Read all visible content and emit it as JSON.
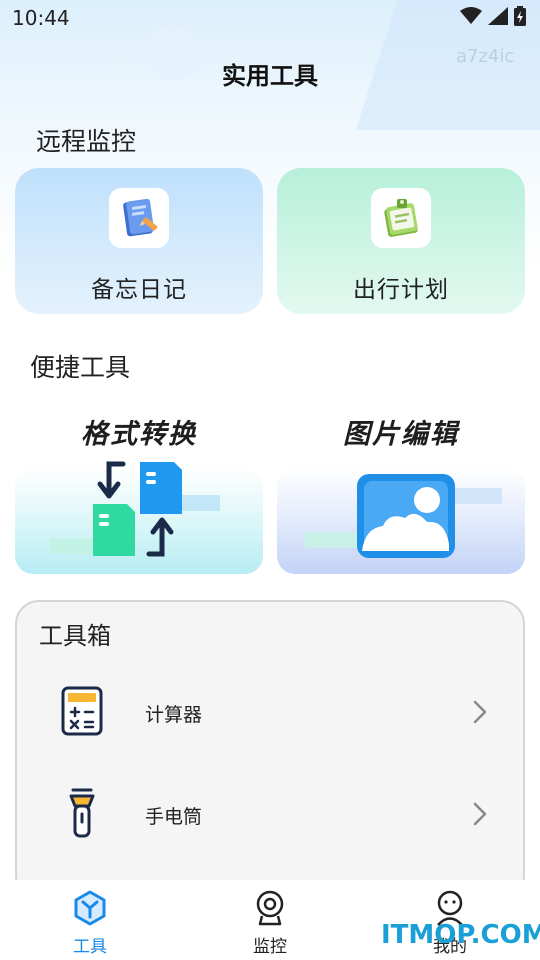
{
  "status": {
    "time": "10:44",
    "icons": [
      "wifi-icon",
      "signal-icon",
      "battery-icon"
    ]
  },
  "watermark_top": "a7z4ic",
  "header": {
    "title": "实用工具"
  },
  "remote": {
    "section_title": "远程监控",
    "cards": [
      {
        "label": "备忘日记",
        "icon": "notebook-icon"
      },
      {
        "label": "出行计划",
        "icon": "clipboard-icon"
      }
    ]
  },
  "quick": {
    "section_title": "便捷工具",
    "cards": [
      {
        "label": "格式转换",
        "icon": "file-convert-icon"
      },
      {
        "label": "图片编辑",
        "icon": "image-icon"
      }
    ]
  },
  "toolbox": {
    "title": "工具箱",
    "items": [
      {
        "label": "计算器",
        "icon": "calculator-icon"
      },
      {
        "label": "手电筒",
        "icon": "flashlight-icon"
      }
    ]
  },
  "nav": {
    "items": [
      {
        "label": "工具",
        "icon": "tools-hex-icon",
        "active": true
      },
      {
        "label": "监控",
        "icon": "webcam-icon",
        "active": false
      },
      {
        "label": "我的",
        "icon": "profile-icon",
        "active": false
      }
    ]
  },
  "watermark_bottom": "ITMOP.COM",
  "colors": {
    "accent": "#1a88e8",
    "memo_card": "#bfe0fb",
    "trip_card": "#b7f0da",
    "convert_green": "#2fd9a0",
    "convert_blue": "#1f98f0"
  }
}
